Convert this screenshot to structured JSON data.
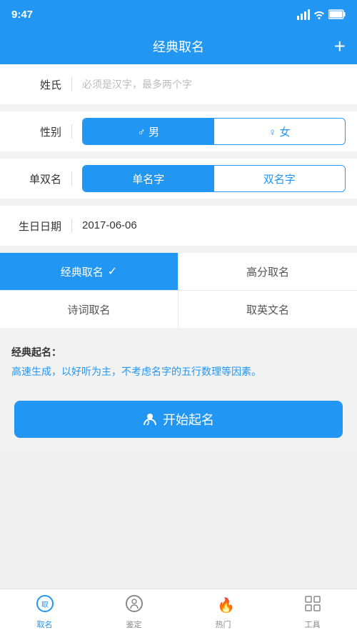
{
  "statusBar": {
    "time": "9:47"
  },
  "header": {
    "title": "经典取名",
    "addButton": "+"
  },
  "form": {
    "surname": {
      "label": "姓氏",
      "placeholder": "必须是汉字，最多两个字",
      "value": ""
    },
    "gender": {
      "label": "性别",
      "options": [
        {
          "id": "male",
          "label": "♂ 男",
          "active": true
        },
        {
          "id": "female",
          "label": "♀ 女",
          "active": false
        }
      ]
    },
    "nameType": {
      "label": "单双名",
      "options": [
        {
          "id": "single",
          "label": "单名字",
          "active": true
        },
        {
          "id": "double",
          "label": "双名字",
          "active": false
        }
      ]
    },
    "birthday": {
      "label": "生日日期",
      "value": "2017-06-06"
    }
  },
  "nameMethods": {
    "items": [
      {
        "id": "classic",
        "label": "经典取名",
        "active": true,
        "hasCheck": true
      },
      {
        "id": "highscore",
        "label": "高分取名",
        "active": false,
        "hasCheck": false
      },
      {
        "id": "poetry",
        "label": "诗词取名",
        "active": false,
        "hasCheck": false
      },
      {
        "id": "english",
        "label": "取英文名",
        "active": false,
        "hasCheck": false
      }
    ]
  },
  "description": {
    "title": "经典起名：",
    "body": "高速生成，以好听为主，不考虑名字的五行数理等因素。"
  },
  "startButton": {
    "label": "开始起名"
  },
  "tabBar": {
    "items": [
      {
        "id": "naming",
        "label": "取名",
        "active": true,
        "icon": "naming"
      },
      {
        "id": "appraise",
        "label": "鉴定",
        "active": false,
        "icon": "appraise"
      },
      {
        "id": "hot",
        "label": "热门",
        "active": false,
        "icon": "hot"
      },
      {
        "id": "tools",
        "label": "工具",
        "active": false,
        "icon": "tools"
      }
    ]
  }
}
